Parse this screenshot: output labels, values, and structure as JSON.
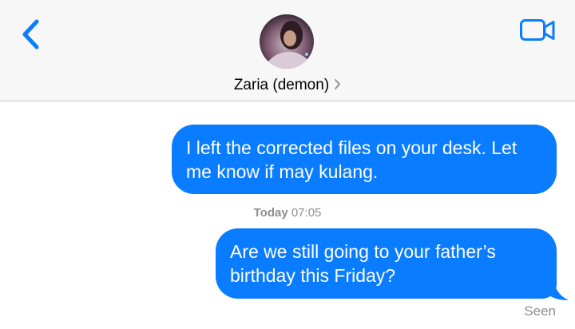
{
  "header": {
    "contact_name": "Zaria (demon)",
    "back_icon": "chevron-left-icon",
    "video_icon": "video-camera-icon",
    "detail_icon": "chevron-right-icon"
  },
  "messages": [
    {
      "text": "I left the corrected files on your desk. Let me know if may kulang.",
      "direction": "sent"
    },
    {
      "text": "Are we still going to your father’s birthday this Friday?",
      "direction": "sent"
    }
  ],
  "timestamp": {
    "day": "Today",
    "time": "07:05"
  },
  "status": "Seen",
  "colors": {
    "bubble": "#0a7cff",
    "accent": "#0a7cff",
    "meta": "#8e8e93"
  }
}
